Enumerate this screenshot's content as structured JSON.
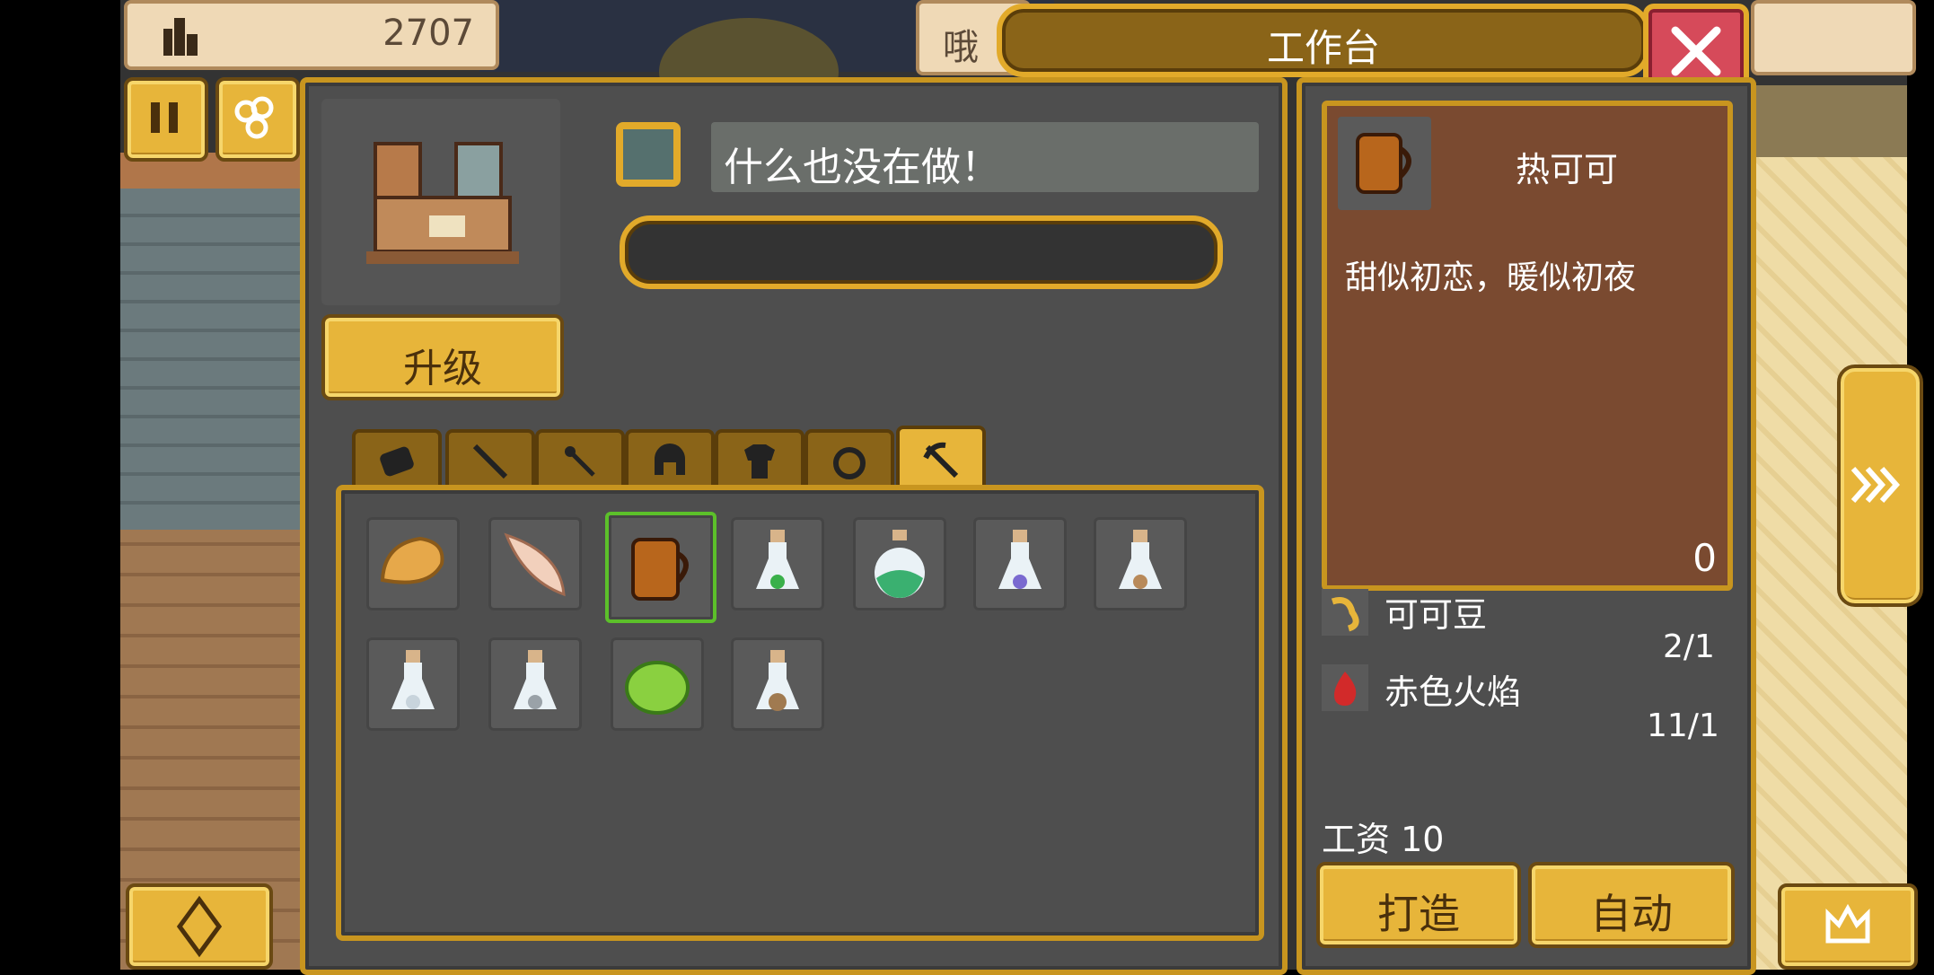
{
  "hud": {
    "gold_value": "2707",
    "other_tab_text": "哦",
    "window_title": "工作台"
  },
  "station": {
    "status_text": "什么也没在做！",
    "progress": 0,
    "upgrade_label": "升级"
  },
  "tabs": [
    {
      "icon": "scroll-icon"
    },
    {
      "icon": "sword-icon"
    },
    {
      "icon": "staff-icon"
    },
    {
      "icon": "helmet-icon"
    },
    {
      "icon": "armor-icon"
    },
    {
      "icon": "ring-icon"
    },
    {
      "icon": "pickaxe-icon",
      "active": true
    }
  ],
  "items": [
    {
      "icon": "bread-icon"
    },
    {
      "icon": "feather-icon"
    },
    {
      "icon": "hot-cocoa-icon",
      "selected": true
    },
    {
      "icon": "green-potion-icon"
    },
    {
      "icon": "big-green-potion-icon"
    },
    {
      "icon": "purple-potion-icon"
    },
    {
      "icon": "orange-potion-icon"
    },
    {
      "icon": "white-potion-icon"
    },
    {
      "icon": "grey-potion-icon"
    },
    {
      "icon": "green-slime-icon"
    },
    {
      "icon": "brown-potion-icon"
    }
  ],
  "detail": {
    "item_name": "热可可",
    "description": "甜似初恋，暖似初夜",
    "count": "0",
    "ingredients": [
      {
        "name": "可可豆",
        "amount": "2/1",
        "icon": "cocoa-bean-icon"
      },
      {
        "name": "赤色火焰",
        "amount": "11/1",
        "icon": "red-flame-icon"
      }
    ],
    "wage_label": "工资 10",
    "craft_label": "打造",
    "auto_label": "自动"
  },
  "colors": {
    "gold": "#e7b53a",
    "panel": "#4e4e4e",
    "detail_bg": "#7a4a30",
    "selected_border": "#5cc02a"
  }
}
